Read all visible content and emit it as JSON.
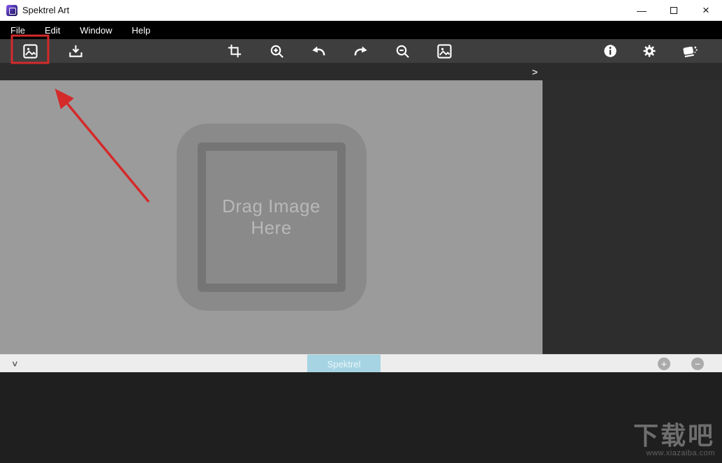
{
  "window": {
    "title": "Spektrel Art",
    "controls": {
      "minimize": "—",
      "close": "×"
    }
  },
  "menubar": {
    "items": [
      {
        "label": "File"
      },
      {
        "label": "Edit"
      },
      {
        "label": "Window"
      },
      {
        "label": "Help"
      }
    ]
  },
  "toolbar": {
    "icons": {
      "open_image": "open-image-icon",
      "import_image": "import-image-icon",
      "crop": "crop-icon",
      "zoom_in": "zoom-in-icon",
      "undo": "undo-arrow-icon",
      "redo": "redo-arrow-icon",
      "zoom_out": "zoom-out-icon",
      "insert_image": "insert-image-icon",
      "info": "info-icon",
      "settings": "gear-icon",
      "stamp": "stamp-icon"
    }
  },
  "panel": {
    "expand_chevron": ">"
  },
  "canvas": {
    "dropzone": {
      "line1": "Drag Image",
      "line2": "Here"
    }
  },
  "timeline": {
    "collapse_chevron": ">",
    "layer_label": "Spektrel",
    "zoom_in_label": "+",
    "zoom_out_label": "−"
  },
  "watermark": {
    "title": "下载吧",
    "url": "www.xiazaiba.com"
  },
  "colors": {
    "annotation_red": "#d42a2a",
    "toolbar_bg": "#3e3e3e",
    "layer_accent": "#a6d4e2",
    "canvas_gray": "#9b9b9b"
  }
}
